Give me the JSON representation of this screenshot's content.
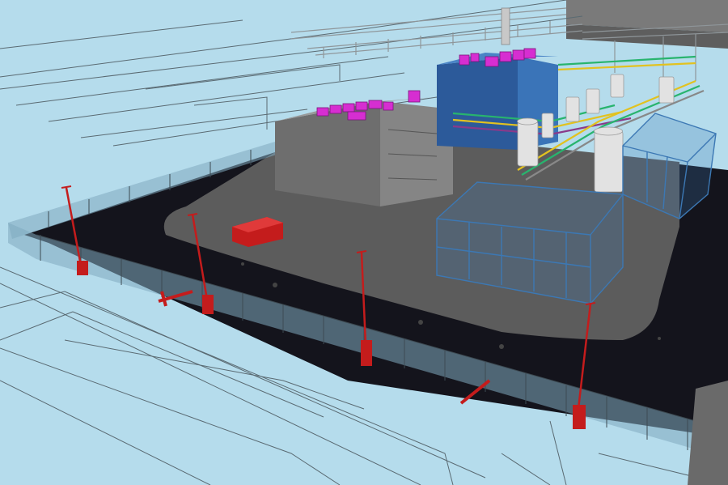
{
  "viewport": {
    "background_color": "#b5dcec",
    "linework_color": "#5a6a72",
    "fence_color": "#7fa9c0",
    "ground_color": "#14141c",
    "pad_color": "#5c5c5c",
    "building_color": "#6e6e6e",
    "structure_color": "#3c78b4",
    "equipment_color": "#d62ed1",
    "pole_color": "#c41c1c",
    "tank_color": "#e2e2e2"
  }
}
